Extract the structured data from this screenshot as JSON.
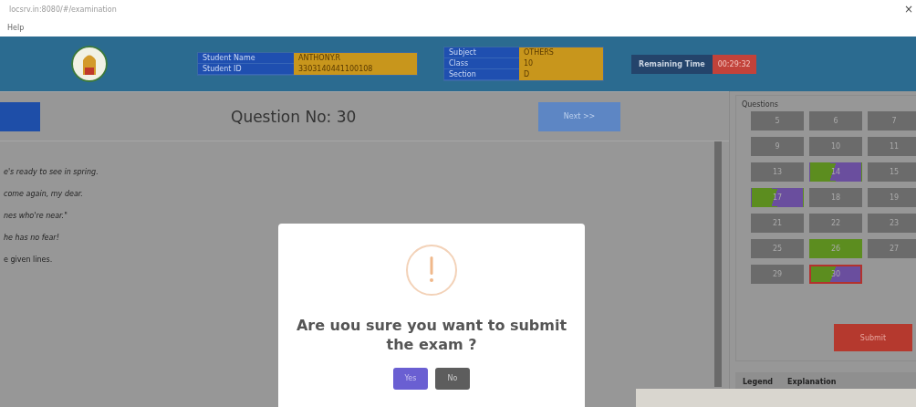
{
  "address_bar": {
    "url": "locsrv.in:8080/#/examination",
    "close": "×"
  },
  "menu": [
    "Help"
  ],
  "header": {
    "student": [
      {
        "label": "Student Name",
        "value": "ANTHONY.R"
      },
      {
        "label": "Student ID",
        "value": "3303140441100108"
      }
    ],
    "exam": [
      {
        "label": "Subject",
        "value": "OTHERS"
      },
      {
        "label": "Class",
        "value": "10"
      },
      {
        "label": "Section",
        "value": "D"
      }
    ],
    "timer": {
      "label": "Remaining Time",
      "value": "00:29:32"
    }
  },
  "question": {
    "title": "Question No: 30",
    "next": "Next >>",
    "lines": [
      {
        "text": "e's ready to see in spring.",
        "italic": true
      },
      {
        "text": "come again, my dear.",
        "italic": true
      },
      {
        "text": "nes who're near.\"",
        "italic": true
      },
      {
        "text": "he has no fear!",
        "italic": true
      },
      {
        "text": "e given lines.",
        "italic": false
      }
    ]
  },
  "palette": {
    "title": "Questions",
    "submit": "Submit",
    "items": [
      {
        "number": "5",
        "kind": "plain",
        "selected": false
      },
      {
        "number": "6",
        "kind": "plain",
        "selected": false
      },
      {
        "number": "7",
        "kind": "plain",
        "selected": false
      },
      {
        "number": "9",
        "kind": "plain",
        "selected": false
      },
      {
        "number": "10",
        "kind": "plain",
        "selected": false
      },
      {
        "number": "11",
        "kind": "plain",
        "selected": false
      },
      {
        "number": "13",
        "kind": "plain",
        "selected": false
      },
      {
        "number": "14",
        "kind": "split",
        "selected": false
      },
      {
        "number": "15",
        "kind": "plain",
        "selected": false
      },
      {
        "number": "17",
        "kind": "split",
        "selected": false
      },
      {
        "number": "18",
        "kind": "plain",
        "selected": false
      },
      {
        "number": "19",
        "kind": "plain",
        "selected": false
      },
      {
        "number": "21",
        "kind": "plain",
        "selected": false
      },
      {
        "number": "22",
        "kind": "plain",
        "selected": false
      },
      {
        "number": "23",
        "kind": "plain",
        "selected": false
      },
      {
        "number": "25",
        "kind": "plain",
        "selected": false
      },
      {
        "number": "26",
        "kind": "answered",
        "selected": false
      },
      {
        "number": "27",
        "kind": "plain",
        "selected": false
      },
      {
        "number": "29",
        "kind": "plain",
        "selected": false
      },
      {
        "number": "30",
        "kind": "split",
        "selected": true
      }
    ]
  },
  "legend": {
    "columns": [
      "Legend",
      "Explanation"
    ]
  },
  "dialog": {
    "message": "Are uou sure you want to submit the exam ?",
    "buttons": [
      {
        "label": "Yes",
        "kind": "confirm"
      },
      {
        "label": "No",
        "kind": "cancel"
      }
    ]
  }
}
